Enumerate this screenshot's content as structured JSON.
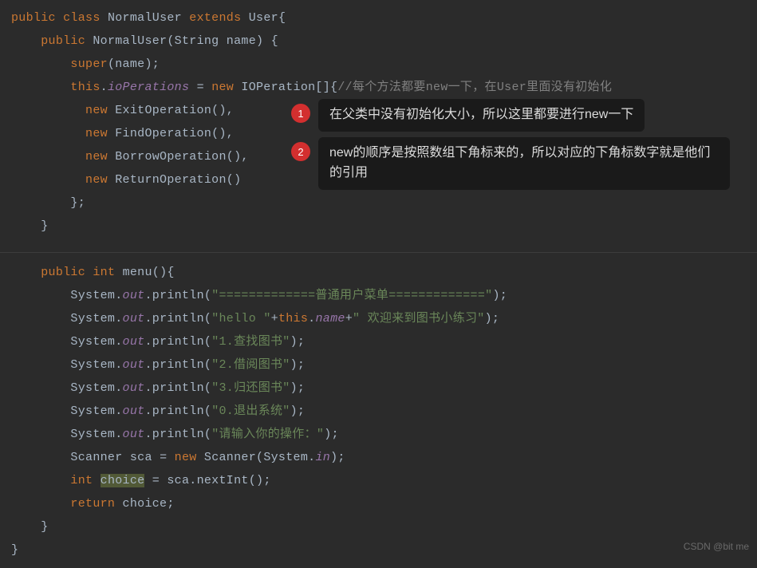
{
  "code": {
    "class_keyword1": "public",
    "class_keyword2": "class",
    "class_name": "NormalUser",
    "extends_kw": "extends",
    "parent_class": "User",
    "brace_open": "{",
    "brace_close": "}",
    "ctor_kw": "public",
    "ctor_name": "NormalUser",
    "ctor_params_open": "(",
    "ctor_type": "String",
    "ctor_param": "name",
    "ctor_params_close": ")",
    "super_kw": "super",
    "super_call_open": "(",
    "super_arg": "name",
    "super_call_close": ")",
    "semi": ";",
    "this_kw": "this",
    "dot": ".",
    "field_name": "ioPerations",
    "assign": " = ",
    "new_kw": "new",
    "arr_type": "IOPeration",
    "arr_brackets": "[]{",
    "arr_comment": "//每个方法都要new一下，在User里面没有初始化",
    "ops": [
      "ExitOperation",
      "FindOperation",
      "BorrowOperation",
      "ReturnOperation"
    ],
    "parens": "()",
    "comma": ",",
    "arr_close": "}",
    "menu_kw1": "public",
    "menu_kw2": "int",
    "menu_name": "menu",
    "menu_params": "()",
    "system": "System",
    "out": "out",
    "println": "println",
    "print_strings": [
      "\"=============普通用户菜单=============\"",
      "\"hello \"",
      "\" 欢迎来到图书小练习\"",
      "\"1.查找图书\"",
      "\"2.借阅图书\"",
      "\"3.归还图书\"",
      "\"0.退出系统\"",
      "\"请输入你的操作：\""
    ],
    "plus": "+",
    "name_field": "name",
    "scanner_type": "Scanner",
    "scanner_var": "sca",
    "scanner_arg": "System",
    "in_field": "in",
    "int_kw": "int",
    "choice_var": "choice",
    "nextInt": "nextInt",
    "return_kw": "return"
  },
  "callouts": [
    {
      "num": "1",
      "text": "在父类中没有初始化大小，所以这里都要进行new一下"
    },
    {
      "num": "2",
      "text": "new的顺序是按照数组下角标来的，所以对应的下角标数字就是他们的引用"
    }
  ],
  "watermark": "CSDN @bit me"
}
